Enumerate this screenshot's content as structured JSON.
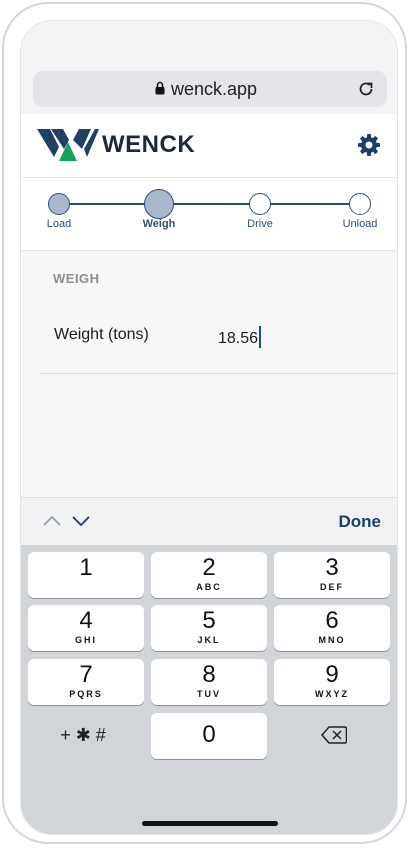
{
  "browser": {
    "url": "wenck.app"
  },
  "header": {
    "brand": "WENCK"
  },
  "stepper": {
    "steps": [
      {
        "label": "Load",
        "state": "done"
      },
      {
        "label": "Weigh",
        "state": "current"
      },
      {
        "label": "Drive",
        "state": "upcoming"
      },
      {
        "label": "Unload",
        "state": "upcoming"
      }
    ]
  },
  "form": {
    "section_title": "WEIGH",
    "weight_label": "Weight (tons)",
    "weight_value": "18.56"
  },
  "toolbar": {
    "done_label": "Done"
  },
  "keypad": {
    "keys": [
      {
        "digit": "1",
        "letters": ""
      },
      {
        "digit": "2",
        "letters": "ABC"
      },
      {
        "digit": "3",
        "letters": "DEF"
      },
      {
        "digit": "4",
        "letters": "GHI"
      },
      {
        "digit": "5",
        "letters": "JKL"
      },
      {
        "digit": "6",
        "letters": "MNO"
      },
      {
        "digit": "7",
        "letters": "PQRS"
      },
      {
        "digit": "8",
        "letters": "TUV"
      },
      {
        "digit": "9",
        "letters": "WXYZ"
      },
      {
        "digit": "0",
        "letters": ""
      }
    ],
    "symbols_label": "+ ✱ #"
  },
  "colors": {
    "accent": "#1b3f6b",
    "step_fill": "#a7b8cd",
    "logo_green": "#1aa15a"
  },
  "icons": [
    "lock-icon",
    "reload-icon",
    "gear-icon",
    "chevron-up-icon",
    "chevron-down-icon",
    "backspace-icon"
  ]
}
